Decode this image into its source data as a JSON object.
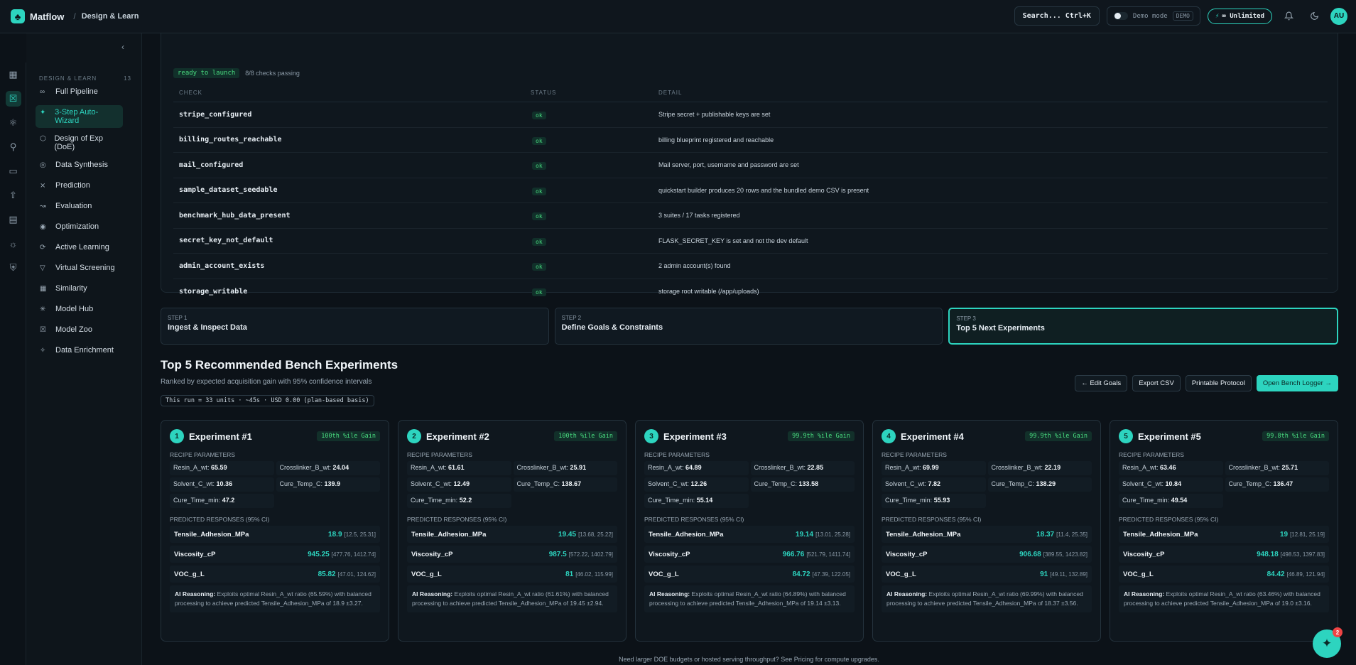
{
  "app": {
    "name": "Matflow",
    "breadcrumb": "Design & Learn"
  },
  "topbar": {
    "search_label": "Search... Ctrl+K",
    "demo_label": "Demo mode",
    "demo_badge": "DEMO",
    "plan_label": "∞ Unlimited",
    "avatar": "AU"
  },
  "sidebar": {
    "section_label": "DESIGN & LEARN",
    "section_count": "13",
    "items": [
      {
        "label": "Full Pipeline",
        "icon": "pipeline-icon"
      },
      {
        "label": "3-Step Auto-Wizard",
        "icon": "wand-icon"
      },
      {
        "label": "Design of Exp (DoE)",
        "icon": "cube-icon"
      },
      {
        "label": "Data Synthesis",
        "icon": "flask-icon"
      },
      {
        "label": "Prediction",
        "icon": "scatter-icon"
      },
      {
        "label": "Evaluation",
        "icon": "chart-icon"
      },
      {
        "label": "Optimization",
        "icon": "target-icon"
      },
      {
        "label": "Active Learning",
        "icon": "refresh-icon"
      },
      {
        "label": "Virtual Screening",
        "icon": "filter-icon"
      },
      {
        "label": "Similarity",
        "icon": "grid-icon"
      },
      {
        "label": "Model Hub",
        "icon": "hub-icon"
      },
      {
        "label": "Model Zoo",
        "icon": "box-icon"
      },
      {
        "label": "Data Enrichment",
        "icon": "sparkle-icon"
      }
    ]
  },
  "checks": {
    "status_badge": "ready to launch",
    "summary": "8/8 checks passing",
    "headers": {
      "check": "CHECK",
      "status": "STATUS",
      "detail": "DETAIL"
    },
    "rows": [
      {
        "check": "stripe_configured",
        "status": "ok",
        "detail": "Stripe secret + publishable keys are set"
      },
      {
        "check": "billing_routes_reachable",
        "status": "ok",
        "detail": "billing blueprint registered and reachable"
      },
      {
        "check": "mail_configured",
        "status": "ok",
        "detail": "Mail server, port, username and password are set"
      },
      {
        "check": "sample_dataset_seedable",
        "status": "ok",
        "detail": "quickstart builder produces 20 rows and the bundled demo CSV is present"
      },
      {
        "check": "benchmark_hub_data_present",
        "status": "ok",
        "detail": "3 suites / 17 tasks registered"
      },
      {
        "check": "secret_key_not_default",
        "status": "ok",
        "detail": "FLASK_SECRET_KEY is set and not the dev default"
      },
      {
        "check": "admin_account_exists",
        "status": "ok",
        "detail": "2 admin account(s) found"
      },
      {
        "check": "storage_writable",
        "status": "ok",
        "detail": "storage root writable (/app/uploads)"
      }
    ]
  },
  "steps": [
    {
      "num": "STEP 1",
      "title": "Ingest & Inspect Data"
    },
    {
      "num": "STEP 2",
      "title": "Define Goals & Constraints"
    },
    {
      "num": "STEP 3",
      "title": "Top 5 Next Experiments"
    }
  ],
  "section": {
    "title": "Top 5 Recommended Bench Experiments",
    "subtitle": "Ranked by expected acquisition gain with 95% confidence intervals",
    "budget": "This run = 33 units · ~45s · USD 0.00 (plan-based basis)"
  },
  "actions": {
    "edit_goals": "← Edit Goals",
    "export_csv": "Export CSV",
    "printable": "Printable Protocol",
    "open_logger": "Open Bench Logger →"
  },
  "labels": {
    "recipe": "RECIPE PARAMETERS",
    "predicted": "PREDICTED RESPONSES (95% CI)",
    "ai_reasoning": "AI Reasoning:"
  },
  "experiments": [
    {
      "num": "1",
      "title": "Experiment #1",
      "gain": "100th %ile Gain",
      "params": [
        [
          "Resin_A_wt:",
          "65.59"
        ],
        [
          "Crosslinker_B_wt:",
          "24.04"
        ],
        [
          "Solvent_C_wt:",
          "10.36"
        ],
        [
          "Cure_Temp_C:",
          "139.9"
        ],
        [
          "Cure_Time_min:",
          "47.2"
        ]
      ],
      "responses": [
        [
          "Tensile_Adhesion_MPa",
          "18.9",
          "[12.5, 25.31]"
        ],
        [
          "Viscosity_cP",
          "945.25",
          "[477.76, 1412.74]"
        ],
        [
          "VOC_g_L",
          "85.82",
          "[47.01, 124.62]"
        ]
      ],
      "reasoning": "Exploits optimal Resin_A_wt ratio (65.59%) with balanced processing to achieve predicted Tensile_Adhesion_MPa of 18.9 ±3.27."
    },
    {
      "num": "2",
      "title": "Experiment #2",
      "gain": "100th %ile Gain",
      "params": [
        [
          "Resin_A_wt:",
          "61.61"
        ],
        [
          "Crosslinker_B_wt:",
          "25.91"
        ],
        [
          "Solvent_C_wt:",
          "12.49"
        ],
        [
          "Cure_Temp_C:",
          "138.67"
        ],
        [
          "Cure_Time_min:",
          "52.2"
        ]
      ],
      "responses": [
        [
          "Tensile_Adhesion_MPa",
          "19.45",
          "[13.68, 25.22]"
        ],
        [
          "Viscosity_cP",
          "987.5",
          "[572.22, 1402.79]"
        ],
        [
          "VOC_g_L",
          "81",
          "[46.02, 115.99]"
        ]
      ],
      "reasoning": "Exploits optimal Resin_A_wt ratio (61.61%) with balanced processing to achieve predicted Tensile_Adhesion_MPa of 19.45 ±2.94."
    },
    {
      "num": "3",
      "title": "Experiment #3",
      "gain": "99.9th %ile Gain",
      "params": [
        [
          "Resin_A_wt:",
          "64.89"
        ],
        [
          "Crosslinker_B_wt:",
          "22.85"
        ],
        [
          "Solvent_C_wt:",
          "12.26"
        ],
        [
          "Cure_Temp_C:",
          "133.58"
        ],
        [
          "Cure_Time_min:",
          "55.14"
        ]
      ],
      "responses": [
        [
          "Tensile_Adhesion_MPa",
          "19.14",
          "[13.01, 25.28]"
        ],
        [
          "Viscosity_cP",
          "966.76",
          "[521.79, 1411.74]"
        ],
        [
          "VOC_g_L",
          "84.72",
          "[47.39, 122.05]"
        ]
      ],
      "reasoning": "Exploits optimal Resin_A_wt ratio (64.89%) with balanced processing to achieve predicted Tensile_Adhesion_MPa of 19.14 ±3.13."
    },
    {
      "num": "4",
      "title": "Experiment #4",
      "gain": "99.9th %ile Gain",
      "params": [
        [
          "Resin_A_wt:",
          "69.99"
        ],
        [
          "Crosslinker_B_wt:",
          "22.19"
        ],
        [
          "Solvent_C_wt:",
          "7.82"
        ],
        [
          "Cure_Temp_C:",
          "138.29"
        ],
        [
          "Cure_Time_min:",
          "55.93"
        ]
      ],
      "responses": [
        [
          "Tensile_Adhesion_MPa",
          "18.37",
          "[11.4, 25.35]"
        ],
        [
          "Viscosity_cP",
          "906.68",
          "[389.55, 1423.82]"
        ],
        [
          "VOC_g_L",
          "91",
          "[49.11, 132.89]"
        ]
      ],
      "reasoning": "Exploits optimal Resin_A_wt ratio (69.99%) with balanced processing to achieve predicted Tensile_Adhesion_MPa of 18.37 ±3.56."
    },
    {
      "num": "5",
      "title": "Experiment #5",
      "gain": "99.8th %ile Gain",
      "params": [
        [
          "Resin_A_wt:",
          "63.46"
        ],
        [
          "Crosslinker_B_wt:",
          "25.71"
        ],
        [
          "Solvent_C_wt:",
          "10.84"
        ],
        [
          "Cure_Temp_C:",
          "136.47"
        ],
        [
          "Cure_Time_min:",
          "49.54"
        ]
      ],
      "responses": [
        [
          "Tensile_Adhesion_MPa",
          "19",
          "[12.81, 25.19]"
        ],
        [
          "Viscosity_cP",
          "948.18",
          "[498.53, 1397.83]"
        ],
        [
          "VOC_g_L",
          "84.42",
          "[46.89, 121.94]"
        ]
      ],
      "reasoning": "Exploits optimal Resin_A_wt ratio (63.46%) with balanced processing to achieve predicted Tensile_Adhesion_MPa of 19.0 ±3.16."
    }
  ],
  "footer_note": "Need larger DOE budgets or hosted serving throughput? See Pricing for compute upgrades.",
  "fab_badge": "2",
  "colors": {
    "accent": "#2dd4bf",
    "ok_green": "#4ade80",
    "background": "#0c1218"
  }
}
